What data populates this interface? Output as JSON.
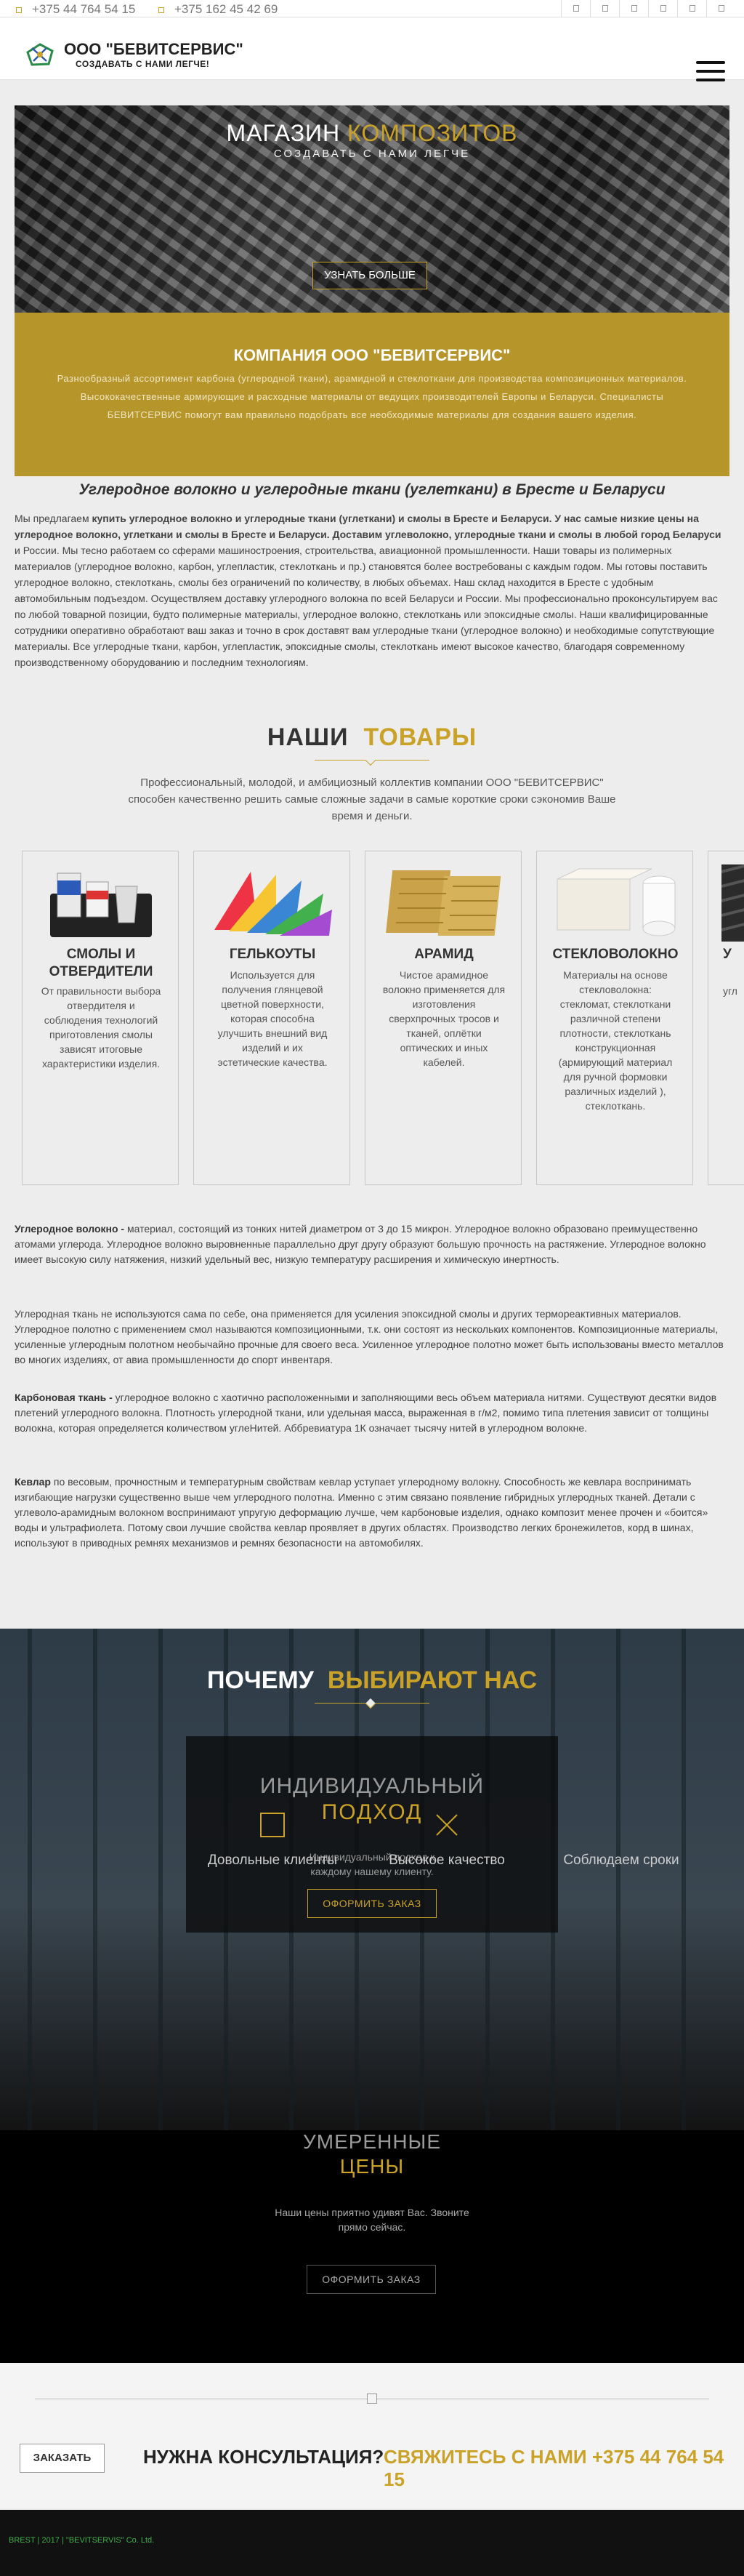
{
  "topbar": {
    "phone1": "+375 44 764 54 15",
    "phone2": "+375 162 45 42 69"
  },
  "header": {
    "logo_title": "ООО \"БЕВИТСЕРВИС\"",
    "logo_sub": "СОЗДАВАТЬ С НАМИ ЛЕГЧЕ!"
  },
  "hero": {
    "title_white": "МАГАЗИН",
    "title_gold": "КОМПОЗИТОВ",
    "subtitle": "СОЗДАВАТЬ С НАМИ ЛЕГЧЕ",
    "button": "УЗНАТЬ БОЛЬШЕ"
  },
  "company": {
    "title": "КОМПАНИЯ ООО \"БЕВИТСЕРВИС\"",
    "text": "Разнообразный ассортимент карбона (углеродной ткани), арамидной и стеклоткани для производства композиционных материалов. Высококачественные армирующие и расходные материалы от ведущих производителей Европы и Беларуси. Специалисты БЕВИТСЕРВИС помогут вам правильно подобрать все необходимые материалы для создания вашего изделия."
  },
  "intro": {
    "heading": "Углеродное волокно и углеродные ткани (углеткани) в Бресте и Беларуси",
    "p_lead": "Мы предлагаем ",
    "p_bold": "купить углеродное волокно и углеродные ткани (углеткани) и смолы в Бресте и Беларуси. У нас самые низкие цены на углеродное волокно, углеткани и смолы в Бресте и Беларуси. Доставим углеволокно, углеродные ткани и смолы в любой город Беларуси",
    "p_rest": " и России. Мы тесно работаем со сферами машиностроения, строительства, авиационной промышленности. Наши товары из полимерных материалов (углеродное волокно, карбон, углепластик, стеклоткань и пр.) становятся более востребованы с каждым годом. Мы готовы поставить углеродное волокно, стеклоткань, смолы без ограничений по количеству, в любых объемах. Наш склад находится в Бресте с удобным автомобильным подъездом. Осуществляем доставку углеродного волокна по всей Беларуси и России. Мы профессионально проконсультируем вас по любой товарной позиции, будто полимерные материалы, углеродное волокно, стеклоткань или эпоксидные смолы. Наши квалифицированные сотрудники оперативно обработают ваш заказ и точно в срок доставят вам углеродные ткани (углеродное волокно) и необходимые сопутствующие материалы. Все углеродные ткани, карбон, углепластик, эпоксидные смолы, стеклоткань имеют высокое качество, благодаря современному производственному оборудованию и последним технологиям."
  },
  "goods": {
    "title_dark": "НАШИ",
    "title_gold": "ТОВАРЫ",
    "description": "Профессиональный, молодой, и амбициозный коллектив компании ООО \"БЕВИТСЕРВИС\" способен качественно решить самые сложные задачи в самые короткие сроки сэкономив Ваше время и деньги."
  },
  "products": [
    {
      "title": "СМОЛЫ И ОТВЕРДИТЕЛИ",
      "text": "От правильности выбора отвердителя и соблюдения технологий приготовления смолы зависят итоговые характеристики изделия."
    },
    {
      "title": "ГЕЛЬКОУТЫ",
      "text": "Используется для получения глянцевой цветной поверхности, которая способна улучшить внешний вид изделий и их эстетические качества."
    },
    {
      "title": "АРАМИД",
      "text": "Чистое арамидное волокно применяется для изготовления сверхпрочных тросов и тканей, оплётки оптических и иных кабелей."
    },
    {
      "title": "СТЕКЛОВОЛОКНО",
      "text": "Материалы на основе стекловолокна: стекломат, стеклоткани различной степени плотности, стеклоткань конструкционная (армирующий материал для ручной формовки различных изделий ), стеклоткань."
    },
    {
      "title": "У",
      "text": "угл"
    }
  ],
  "info": {
    "carbon_term": "Углеродное волокно -",
    "carbon_text": " материал, состоящий из тонких нитей диаметром от 3 до 15 микрон. Углеродное волокно образовано преимущественно атомами углерода. Углеродное волокно выровненные параллельно друг другу образуют большую прочность на растяжение. Углеродное волокно имеет высокую силу натяжения, низкий удельный вес, низкую температуру расширения и химическую инертность.",
    "fabric_text": "Углеродная ткань не используются сама по себе, она применяется для усиления эпоксидной смолы и других термореактивных материалов. Углеродное полотно с применением смол называются композиционными, т.к. они состоят из нескольких компонентов. Композиционные материалы, усиленные углеродным полотном необычайно прочные для своего веса. Усиленное углеродное полотно может быть использованы вместо металлов во многих изделиях, от авиа промышленности до спорт инвентаря.",
    "cfabric_term": "Карбоновая ткань -",
    "cfabric_text": " углеродное волокно с хаотично расположенными и заполняющими весь объем материала нитями. Существуют десятки видов плетений углеродного волокна. Плотность углеродной ткани, или удельная масса, выраженная в г/м2, помимо типа плетения зависит от толщины волокна, которая определяется количеством углеНитей. Аббревиатура 1К означает тысячу нитей в углеродном волокне.",
    "kevlar_term": "Кевлар",
    "kevlar_text": " по весовым, прочностным и температурным свойствам кевлар уступает углеродному волокну. Способность же кевлара воспринимать изгибающие нагрузки существенно выше чем углеродного полотна. Именно с этим связано появление гибридных углеродных тканей. Детали с углеволо-арамидным волокном воспринимают упругую деформацию лучше, чем карбоновые изделия, однако композит менее прочен и «боится» воды и ультрафиолета. Потому свои лучшие свойства кевлар проявляет в других областях. Производство легких бронежилетов, корд в шинах, используют в приводных ремнях механизмов и ремнях безопасности на автомобилях."
  },
  "why": {
    "title_white": "ПОЧЕМУ",
    "title_gold": "ВЫБИРАЮТ НАС",
    "box_title1": "ИНДИВИДУАЛЬНЫЙ",
    "box_title2": "ПОДХОД",
    "box_text": "Индивидуальный подход к каждому нашему клиенту.",
    "box_button": "ОФОРМИТЬ ЗАКАЗ",
    "features": [
      "Довольные клиенты",
      "Высокое качество",
      "Соблюдаем сроки"
    ],
    "price_title1": "УМЕРЕННЫЕ",
    "price_title2": "ЦЕНЫ",
    "price_text": "Наши цены приятно удивят Вас. Звоните прямо сейчас.",
    "price_button": "ОФОРМИТЬ ЗАКАЗ"
  },
  "consult": {
    "order_button": "ЗАКАЗАТЬ",
    "question": "НУЖНА КОНСУЛЬТАЦИЯ?",
    "call": "СВЯЖИТЕСЬ С НАМИ +375 44 764 54 15"
  },
  "footer": {
    "copyright": "BREST | 2017 | \"BEVITSERVIS\" Co. Ltd."
  },
  "colors": {
    "accent": "#c9a227",
    "company_bg": "#b6962a",
    "footer_link": "#3fae4a"
  }
}
